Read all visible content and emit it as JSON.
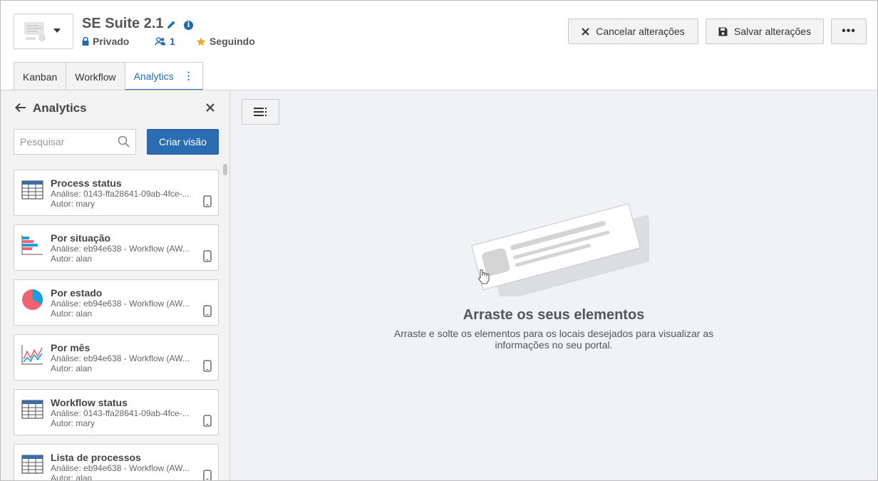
{
  "header": {
    "title": "SE Suite 2.1",
    "privacy": "Privado",
    "members_count": "1",
    "follow": "Seguindo",
    "cancel_label": "Cancelar alterações",
    "save_label": "Salvar alterações",
    "more_label": "•••"
  },
  "tabs": [
    {
      "label": "Kanban",
      "active": false
    },
    {
      "label": "Workflow",
      "active": false
    },
    {
      "label": "Analytics",
      "active": true
    }
  ],
  "sidebar": {
    "title": "Analytics",
    "search_placeholder": "Pesquisar",
    "create_label": "Criar visão",
    "cards": [
      {
        "title": "Process status",
        "analysis": "Análise: 0143-ffa28641-09ab-4fce-...",
        "author": "Autor: mary",
        "icon": "table-icon"
      },
      {
        "title": "Por situação",
        "analysis": "Análise: eb94e638 - Workflow (AW...",
        "author": "Autor: alan",
        "icon": "bar-chart-icon"
      },
      {
        "title": "Por estado",
        "analysis": "Análise: eb94e638 - Workflow (AW...",
        "author": "Autor: alan",
        "icon": "pie-chart-icon"
      },
      {
        "title": "Por mês",
        "analysis": "Análise: eb94e638 - Workflow (AW...",
        "author": "Autor: alan",
        "icon": "line-chart-icon"
      },
      {
        "title": "Workflow status",
        "analysis": "Análise: 0143-ffa28641-09ab-4fce-...",
        "author": "Autor: mary",
        "icon": "table-icon"
      },
      {
        "title": "Lista de processos",
        "analysis": "Análise: eb94e638 - Workflow (AW...",
        "author": "Autor: alan",
        "icon": "table-icon"
      }
    ]
  },
  "main": {
    "empty_title": "Arraste os seus elementos",
    "empty_desc_line1": "Arraste e solte os elementos para os locais desejados para visualizar as",
    "empty_desc_line2": "informações no seu portal."
  },
  "colors": {
    "accent": "#1f6bb5",
    "primary_button": "#2a6db3",
    "star": "#f5a623",
    "panel_bg": "#f3f3f3",
    "main_bg": "#f0f2f6"
  }
}
